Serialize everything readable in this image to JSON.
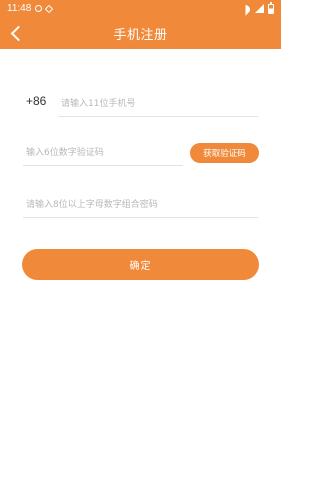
{
  "status_bar": {
    "time": "11:48"
  },
  "header": {
    "title": "手机注册"
  },
  "form": {
    "country_code": "+86",
    "phone_placeholder": "请输入11位手机号",
    "verification_placeholder": "输入6位数字验证码",
    "get_code_label": "获取验证码",
    "password_placeholder": "请输入8位以上字母数字组合密码",
    "confirm_label": "确定"
  },
  "icons": {
    "back": "chevron-left-icon",
    "wifi": "wifi-icon",
    "signal": "signal-icon",
    "battery": "battery-icon"
  },
  "colors": {
    "accent": "#f08a3a",
    "background": "#ffffff",
    "text": "#333333",
    "placeholder": "#b8b8b8",
    "divider": "#e3e3e3"
  }
}
